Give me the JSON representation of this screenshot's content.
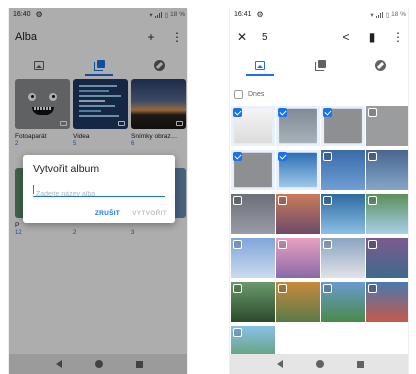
{
  "left": {
    "status": {
      "time": "16:40",
      "battery": "18 %"
    },
    "appbar": {
      "title": "Alba"
    },
    "tabs": [
      "photos",
      "albums",
      "explore"
    ],
    "albums": [
      {
        "name": "Fotoaparát",
        "count": "2",
        "badge": "camera-icon"
      },
      {
        "name": "Videa",
        "count": "5",
        "badge": "video-icon"
      },
      {
        "name": "Snímky obraz…",
        "count": "6",
        "badge": "screenshot-icon"
      }
    ],
    "second_row": {
      "first_name_initial": "P",
      "counts": [
        "12",
        "2",
        "3"
      ]
    },
    "dialog": {
      "title": "Vytvořit album",
      "placeholder": "Zadejte název alba",
      "cancel": "ZRUŠIT",
      "create": "VYTVOŘIT"
    }
  },
  "right": {
    "status": {
      "time": "16:41",
      "battery": "18 %"
    },
    "appbar": {
      "selected_count": "5"
    },
    "section_label": "Dnes",
    "selected_indices": [
      0,
      1,
      2,
      4,
      5
    ],
    "photo_count": 21
  },
  "colors": {
    "accent": "#1a73e8",
    "dim": "rgba(0,0,0,0.32)"
  }
}
